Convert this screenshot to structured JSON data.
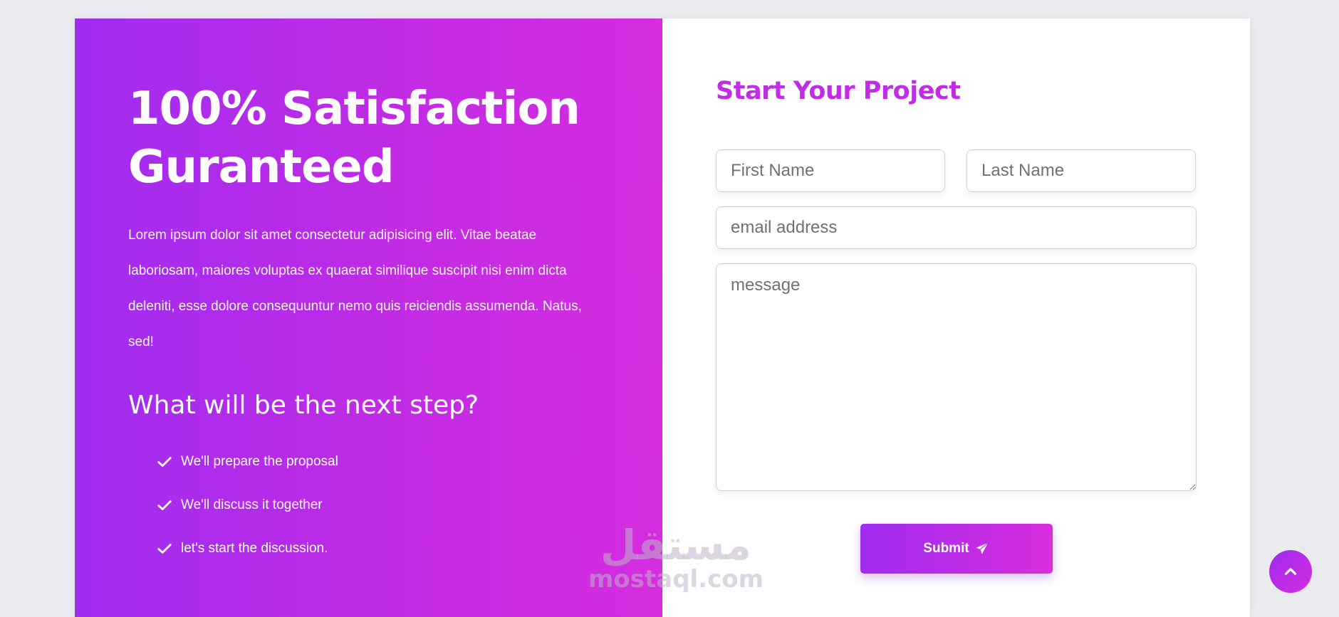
{
  "hero": {
    "title_line1": "100% Satisfaction",
    "title_line2": "Guranteed",
    "text": "Lorem ipsum dolor sit amet consectetur adipisicing elit. Vitae beatae laboriosam, maiores voluptas ex quaerat similique suscipit nisi enim dicta deleniti, esse dolore consequuntur nemo quis reiciendis assumenda. Natus, sed!"
  },
  "next_step": {
    "title": "What will be the next step?",
    "items": [
      {
        "label": "We'll prepare the proposal",
        "icon": "check-icon"
      },
      {
        "label": "We'll discuss it together",
        "icon": "check-icon"
      },
      {
        "label": "let's start the discussion.",
        "icon": "check-icon"
      }
    ]
  },
  "form": {
    "title": "Start Your Project",
    "first_name": {
      "placeholder": "First Name",
      "value": ""
    },
    "last_name": {
      "placeholder": "Last Name",
      "value": ""
    },
    "email": {
      "placeholder": "email address",
      "value": ""
    },
    "message": {
      "placeholder": "message",
      "value": ""
    },
    "submit_label": "Submit",
    "submit_icon": "paper-plane-icon"
  },
  "scroll_top": {
    "icon": "chevron-up-icon"
  },
  "watermark": {
    "arabic": "مستقل",
    "latin": "mostaql.com"
  },
  "colors": {
    "gradient_start": "#a02cf0",
    "gradient_end": "#d52ddf",
    "title_accent": "#c12de6",
    "page_background": "#e9ebee"
  }
}
